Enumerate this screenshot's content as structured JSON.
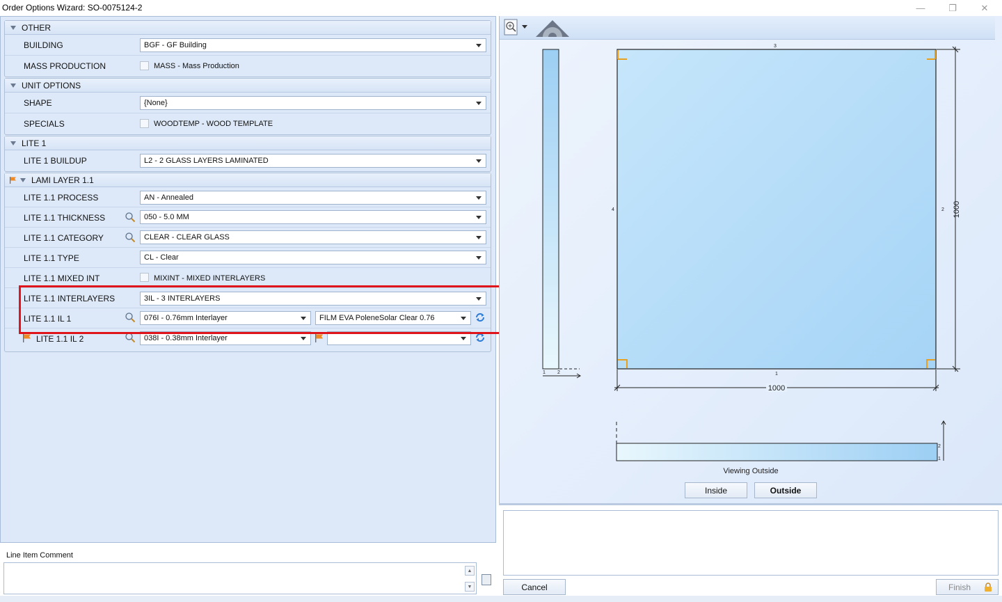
{
  "window": {
    "title": "Order Options Wizard: SO-0075124-2",
    "minimize": "—",
    "maximize": "❐",
    "close": "✕"
  },
  "groups": {
    "other": {
      "title": "OTHER",
      "building_label": "BUILDING",
      "building_value": "BGF - GF Building",
      "mass_label": "MASS PRODUCTION",
      "mass_value": "MASS - Mass Production"
    },
    "unit_options": {
      "title": "UNIT OPTIONS",
      "shape_label": "SHAPE",
      "shape_value": "{None}",
      "specials_label": "SPECIALS",
      "specials_value": "WOODTEMP - WOOD TEMPLATE"
    },
    "lite1": {
      "title": "LITE 1",
      "buildup_label": "LITE 1 BUILDUP",
      "buildup_value": "L2 - 2 GLASS LAYERS LAMINATED"
    },
    "lami": {
      "title": "LAMI LAYER 1.1",
      "process_label": "LITE 1.1 PROCESS",
      "process_value": "AN - Annealed",
      "thickness_label": "LITE 1.1 THICKNESS",
      "thickness_value": "050 - 5.0 MM",
      "category_label": "LITE 1.1 CATEGORY",
      "category_value": "CLEAR - CLEAR GLASS",
      "type_label": "LITE 1.1 TYPE",
      "type_value": "CL - Clear",
      "mixed_label": "LITE 1.1 MIXED INT",
      "mixed_value": "MIXINT - MIXED INTERLAYERS",
      "interlayers_label": "LITE 1.1 INTERLAYERS",
      "interlayers_value": "3IL - 3 INTERLAYERS",
      "il1_label": "LITE 1.1 IL 1",
      "il1_value": "076I - 0.76mm Interlayer",
      "il1_film": "FILM EVA PoleneSolar Clear 0.76",
      "il2_label": "LITE 1.1 IL 2",
      "il2_value": "038I - 0.38mm Interlayer",
      "il2_film": ""
    }
  },
  "comment": {
    "label": "Line Item Comment",
    "value": ""
  },
  "drawing": {
    "edge_top": "3",
    "edge_bottom": "1",
    "edge_left": "4",
    "edge_right": "2",
    "width_dim": "1000",
    "height_dim": "1000",
    "side_1": "1",
    "side_2": "2",
    "strip_2": "2",
    "strip_1": "1",
    "viewing_label": "Viewing Outside"
  },
  "buttons": {
    "inside": "Inside",
    "outside": "Outside",
    "cancel": "Cancel",
    "finish": "Finish"
  },
  "colors": {
    "highlight": "#e0141b",
    "glass": "#aed8f7",
    "corner": "#e8a020"
  }
}
